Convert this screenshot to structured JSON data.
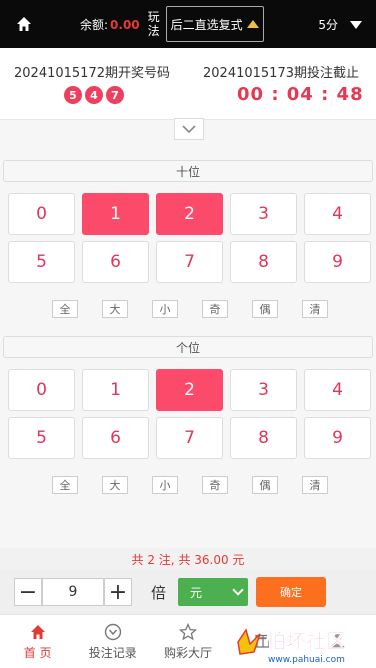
{
  "header": {
    "balance_label": "余额:",
    "balance_value": "0.00",
    "play_label": "玩法",
    "method": "后二直选复式",
    "period": "5分"
  },
  "draw": {
    "last_period_text": "20241015172期开奖号码",
    "last_numbers": [
      "5",
      "4",
      "7"
    ],
    "current_period_text": "20241015173期投注截止",
    "countdown": "00 : 04 : 48"
  },
  "tens": {
    "title": "十位",
    "numbers": [
      "0",
      "1",
      "2",
      "3",
      "4",
      "5",
      "6",
      "7",
      "8",
      "9"
    ],
    "selected": [
      "1",
      "2"
    ],
    "quick": [
      "全",
      "大",
      "小",
      "奇",
      "偶",
      "清"
    ]
  },
  "ones": {
    "title": "个位",
    "numbers": [
      "0",
      "1",
      "2",
      "3",
      "4",
      "5",
      "6",
      "7",
      "8",
      "9"
    ],
    "selected": [
      "2"
    ],
    "quick": [
      "全",
      "大",
      "小",
      "奇",
      "偶",
      "清"
    ]
  },
  "summary": "共 2 注, 共 36.00 元",
  "betbar": {
    "minus": "−",
    "multiplier": "9",
    "plus": "+",
    "bei_label": "倍",
    "unit": "元",
    "confirm": "确定"
  },
  "tabs": [
    {
      "label": "首 页",
      "icon": "home-icon"
    },
    {
      "label": "投注记录",
      "icon": "record-icon"
    },
    {
      "label": "购彩大厅",
      "icon": "star-icon"
    },
    {
      "label": "",
      "icon": "gift-icon"
    },
    {
      "label": "",
      "icon": "user-icon"
    }
  ],
  "watermark": {
    "text": "怕坏社区",
    "url": "www.pahuai.com"
  },
  "colors": {
    "accent": "#fb4a6a",
    "countdown": "#e53952",
    "confirm": "#fb6f1e",
    "unit": "#4caf50"
  }
}
